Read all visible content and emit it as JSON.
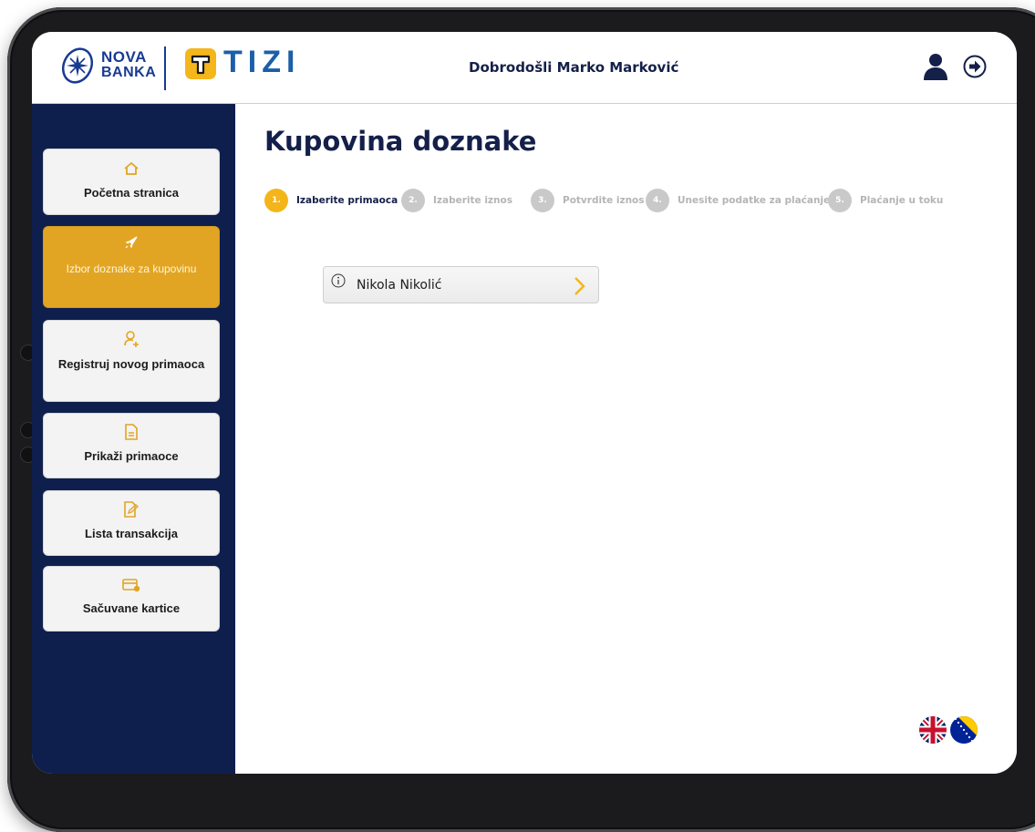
{
  "header": {
    "logo_nova_top": "NOVA",
    "logo_nova_bottom": "BANKA",
    "logo_tizi": "TIZI",
    "welcome": "Dobrodošli Marko Marković",
    "icons": [
      "user-icon",
      "logout-icon"
    ]
  },
  "sidebar": {
    "items": [
      {
        "label": "Početna stranica",
        "icon": "home-icon",
        "active": false
      },
      {
        "label": "Izbor doznake za kupovinu",
        "icon": "rocket-icon",
        "active": true
      },
      {
        "label": "Registruj novog primaoca",
        "icon": "add-user-icon",
        "active": false
      },
      {
        "label": "Prikaži primaoce",
        "icon": "document-icon",
        "active": false
      },
      {
        "label": "Lista transakcija",
        "icon": "edit-document-icon",
        "active": false
      },
      {
        "label": "Sačuvane kartice",
        "icon": "card-icon",
        "active": false
      }
    ]
  },
  "main": {
    "title": "Kupovina doznake",
    "steps": [
      {
        "num": "1.",
        "label": "Izaberite primaoca",
        "active": true
      },
      {
        "num": "2.",
        "label": "Izaberite iznos",
        "active": false
      },
      {
        "num": "3.",
        "label": "Potvrdite iznos",
        "active": false
      },
      {
        "num": "4.",
        "label": "Unesite podatke za plaćanje",
        "active": false
      },
      {
        "num": "5.",
        "label": "Plaćanje u toku",
        "active": false
      }
    ],
    "recipient": {
      "name": "Nikola Nikolić"
    }
  },
  "languages": [
    "en",
    "bs"
  ],
  "colors": {
    "navy": "#0f1f4d",
    "accent": "#f3b519",
    "active_menu": "#e2a523",
    "inactive_step": "#c9c9c9"
  }
}
